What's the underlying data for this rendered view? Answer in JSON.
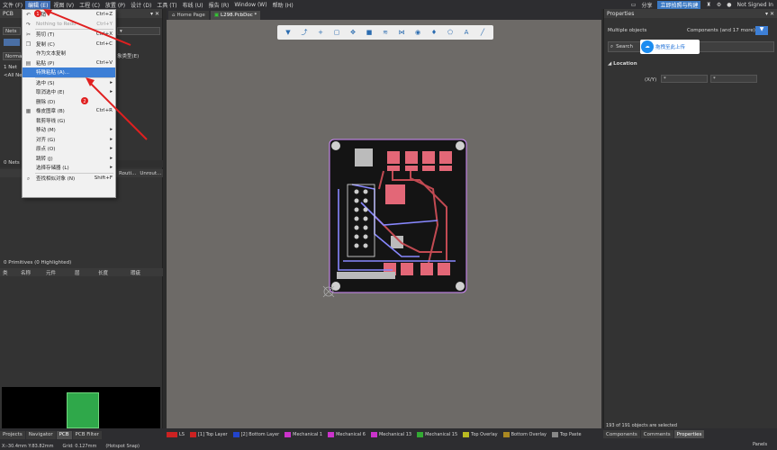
{
  "menubar": {
    "items": [
      "文件 (F)",
      "编辑 (E)",
      "视图 (V)",
      "工程 (C)",
      "放置 (P)",
      "设计 (D)",
      "工具 (T)",
      "布线 (U)",
      "报告 (R)",
      "Window (W)",
      "帮助 (H)"
    ],
    "share": "分享",
    "quick_upload": "立即拍照与构建",
    "signin": "Not Signed In"
  },
  "left_panel": {
    "title": "PCB",
    "nets_label": "Nets",
    "normal_label": "Norma",
    "net_label": "1 Net",
    "all_nets": "<All Ne",
    "nets_count": "0 Nets (",
    "route_col": "Routi...",
    "unroute_col": "Unrout...",
    "primitives": "0 Primitives (0 Highlighted)",
    "prim_cols": [
      "类",
      "名称",
      "元件",
      "层",
      "长度",
      "瑕疵"
    ],
    "hidden_suffix": "象类型(E)"
  },
  "edit_menu": {
    "items": [
      {
        "label": "撤销",
        "sc": "Ctrl+Z",
        "icon": "undo-icon",
        "glyph": "↶"
      },
      {
        "label": "Nothing to Redo",
        "sc": "Ctrl+Y",
        "icon": "redo-icon",
        "glyph": "↷",
        "disabled": true
      },
      {
        "sep": true
      },
      {
        "label": "剪切 (T)",
        "sc": "Ctrl+X",
        "icon": "cut-icon",
        "glyph": "✂"
      },
      {
        "label": "复制 (C)",
        "sc": "Ctrl+C",
        "icon": "copy-icon",
        "glyph": "❐"
      },
      {
        "label": "作为文本复制",
        "sc": "",
        "icon": "",
        "glyph": ""
      },
      {
        "label": "粘贴 (P)",
        "sc": "Ctrl+V",
        "icon": "paste-icon",
        "glyph": "▤"
      },
      {
        "label": "特殊粘贴 (A)...",
        "sc": "",
        "icon": "",
        "glyph": "",
        "highlight": true
      },
      {
        "sep": true
      },
      {
        "label": "选中 (S)",
        "sc": "▸",
        "icon": "",
        "glyph": ""
      },
      {
        "label": "取消选中 (E)",
        "sc": "▸",
        "icon": "",
        "glyph": ""
      },
      {
        "label": "删除 (D)",
        "sc": "",
        "icon": "",
        "glyph": ""
      },
      {
        "label": "橡皮图章 (B)",
        "sc": "Ctrl+R",
        "icon": "stamp-icon",
        "glyph": "▦"
      },
      {
        "label": "裁剪导线 (G)",
        "sc": "",
        "icon": "",
        "glyph": ""
      },
      {
        "label": "移动 (M)",
        "sc": "▸",
        "icon": "",
        "glyph": ""
      },
      {
        "label": "对齐 (G)",
        "sc": "▸",
        "icon": "",
        "glyph": ""
      },
      {
        "label": "原点 (O)",
        "sc": "▸",
        "icon": "",
        "glyph": ""
      },
      {
        "label": "跳转 (J)",
        "sc": "▸",
        "icon": "",
        "glyph": ""
      },
      {
        "label": "选择存储器 (L)",
        "sc": "▸",
        "icon": "",
        "glyph": ""
      },
      {
        "sep": true
      },
      {
        "label": "查找相似对象 (N)",
        "sc": "Shift+F",
        "icon": "find-similar-icon",
        "glyph": "⌕"
      }
    ],
    "markers": [
      "1",
      "2"
    ]
  },
  "tabs": [
    {
      "label": "Home Page",
      "icon": "home-icon"
    },
    {
      "label": "L298.PcbDoc *",
      "icon": "pcb-doc-icon"
    }
  ],
  "right_panel": {
    "title": "Properties",
    "multiple": "Multiple objects",
    "components": "Components (and 17 more)",
    "search_placeholder": "Search",
    "overlay": "拖拽至此上传",
    "location": "Location",
    "xy_label": "(X/Y)",
    "x_value": "*",
    "y_value": "*",
    "selected": "193 of 191 objects are selected"
  },
  "bottom": {
    "panel_tabs": [
      "Projects",
      "Navigator",
      "PCB",
      "PCB Filter"
    ],
    "active_panel_tab": "PCB",
    "right_tabs": [
      "Components",
      "Comments",
      "Properties"
    ],
    "active_right_tab": "Properties",
    "status": [
      "X:-30.4mm Y:83.82mm",
      "Grid: 0.127mm",
      "(Hotspot Snap)"
    ],
    "panels_btn": "Panels",
    "ls_label": "LS",
    "layers": [
      {
        "label": "[1] Top Layer",
        "color": "#cc2222"
      },
      {
        "label": "[2] Bottom Layer",
        "color": "#2244cc"
      },
      {
        "label": "Mechanical 1",
        "color": "#cc33cc"
      },
      {
        "label": "Mechanical 6",
        "color": "#cc33cc"
      },
      {
        "label": "Mechanical 13",
        "color": "#cc33cc"
      },
      {
        "label": "Mechanical 15",
        "color": "#33aa33"
      },
      {
        "label": "Top Overlay",
        "color": "#bbbb22"
      },
      {
        "label": "Bottom Overlay",
        "color": "#aa8822"
      },
      {
        "label": "Top Paste",
        "color": "#888888"
      }
    ]
  },
  "colors": {
    "board": "#141414",
    "pad": "#e36777",
    "silk": "#e6e6e6",
    "trace_red": "#c24a52",
    "trace_blue": "#8888ff",
    "keepout": "#d28cff"
  }
}
